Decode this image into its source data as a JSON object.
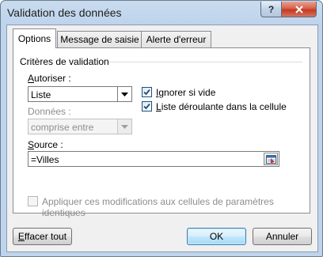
{
  "window": {
    "title": "Validation des données"
  },
  "title_buttons": {
    "help": "?",
    "close": "✕"
  },
  "tabs": [
    {
      "label": "Options"
    },
    {
      "label": "Message de saisie"
    },
    {
      "label": "Alerte d'erreur"
    }
  ],
  "group": {
    "title": "Critères de validation"
  },
  "allow": {
    "label_key": "A",
    "label_rest": "utoriser :",
    "value": "Liste"
  },
  "ignore_blank": {
    "label_key": "I",
    "label_rest": "gnorer si vide",
    "checked": true
  },
  "in_cell_dropdown": {
    "label_key": "L",
    "label_rest": "iste déroulante dans la cellule",
    "checked": true
  },
  "data": {
    "label": "Données :",
    "value": "comprise entre"
  },
  "source": {
    "label_key": "S",
    "label_rest": "ource :",
    "value": "=Villes"
  },
  "apply_all": {
    "label": "Appliquer ces modifications aux cellules de paramètres identiques",
    "checked": false
  },
  "buttons": {
    "clear_all_key": "E",
    "clear_all_rest": "ffacer tout",
    "ok": "OK",
    "cancel": "Annuler"
  },
  "colors": {
    "accent": "#3c7fb1",
    "check": "#1d4f7a"
  },
  "icons": {
    "dropdown": "chevron-down-icon",
    "range_select": "collapse-dialog-icon",
    "check": "checkmark-icon"
  }
}
